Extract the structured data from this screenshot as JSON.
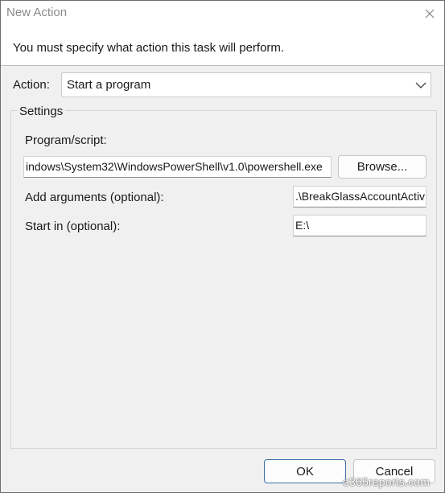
{
  "window": {
    "title": "New Action"
  },
  "header": {
    "instruction": "You must specify what action this task will perform."
  },
  "action": {
    "label": "Action:",
    "selected": "Start a program"
  },
  "settings": {
    "legend": "Settings",
    "program_label": "Program/script:",
    "program_value": "indows\\System32\\WindowsPowerShell\\v1.0\\powershell.exe",
    "browse_label": "Browse...",
    "arguments_label": "Add arguments (optional):",
    "arguments_value": ".\\BreakGlassAccountActiv",
    "start_in_label": "Start in (optional):",
    "start_in_value": "E:\\"
  },
  "buttons": {
    "ok_label": "OK",
    "cancel_label": "Cancel"
  },
  "watermark": "o365reports.com",
  "icons": {
    "close": "close-icon",
    "dropdown": "chevron-down-icon"
  }
}
